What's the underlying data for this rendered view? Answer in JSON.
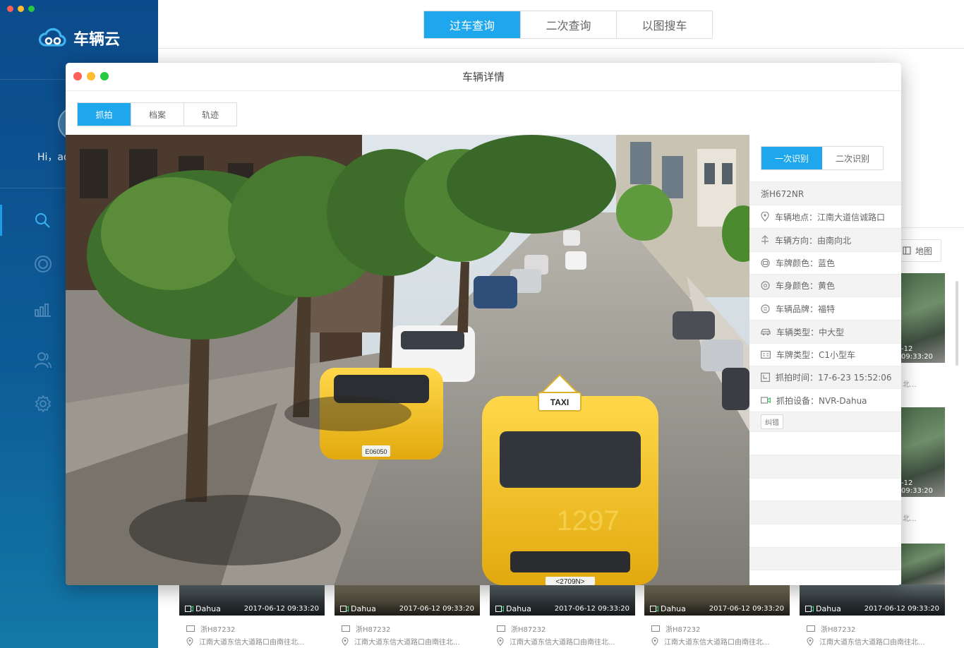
{
  "app": {
    "name": "车辆云",
    "greeting": "Hi，ad"
  },
  "sidebar": {
    "nav": [
      {
        "icon": "search-icon",
        "active": true
      },
      {
        "icon": "target-icon",
        "active": false
      },
      {
        "icon": "bar-chart-icon",
        "active": false
      },
      {
        "icon": "users-icon",
        "active": false
      },
      {
        "icon": "gear-icon",
        "active": false
      }
    ]
  },
  "top_tabs": [
    {
      "label": "过车查询",
      "active": true
    },
    {
      "label": "二次查询",
      "active": false
    },
    {
      "label": "以图搜车",
      "active": false
    }
  ],
  "toolbar": {
    "map_label": "地图"
  },
  "side_results": [
    {
      "time": "-12 09:33:20",
      "snippet": "北..."
    },
    {
      "time": "-12 09:33:20",
      "snippet": "北..."
    }
  ],
  "result_cards": [
    {
      "device": "Dahua",
      "time": "2017-06-12 09:33:20",
      "plate": "浙H87232",
      "address": "江南大道东信大道路口由南往北..."
    },
    {
      "device": "Dahua",
      "time": "2017-06-12 09:33:20",
      "plate": "浙H87232",
      "address": "江南大道东信大道路口由南往北..."
    },
    {
      "device": "Dahua",
      "time": "2017-06-12 09:33:20",
      "plate": "浙H87232",
      "address": "江南大道东信大道路口由南往北..."
    },
    {
      "device": "Dahua",
      "time": "2017-06-12 09:33:20",
      "plate": "浙H87232",
      "address": "江南大道东信大道路口由南往北..."
    },
    {
      "device": "Dahua",
      "time": "2017-06-12 09:33:20",
      "plate": "浙H87232",
      "address": "江南大道东信大道路口由南往北..."
    }
  ],
  "modal": {
    "title": "车辆详情",
    "tabs": [
      {
        "label": "抓拍",
        "active": true
      },
      {
        "label": "档案",
        "active": false
      },
      {
        "label": "轨迹",
        "active": false
      }
    ],
    "photo": {
      "taxi_sign": "TAXI",
      "plate_left": "E06050",
      "plate_right": "<2709N>",
      "body_number": "1297"
    },
    "recognition_tabs": [
      {
        "label": "一次识别",
        "active": true
      },
      {
        "label": "二次识别",
        "active": false
      }
    ],
    "plate": "浙H672NR",
    "details": [
      {
        "icon": "location-pin-icon",
        "text": "车辆地点：江南大道信诚路口"
      },
      {
        "icon": "direction-arrows-icon",
        "text": "车辆方向：由南向北"
      },
      {
        "icon": "plate-color-icon",
        "text": "车牌颜色：蓝色"
      },
      {
        "icon": "body-color-icon",
        "text": "车身颜色：黄色"
      },
      {
        "icon": "brand-icon",
        "text": "车辆品牌：福特"
      },
      {
        "icon": "car-icon",
        "text": "车辆类型：中大型"
      },
      {
        "icon": "plate-type-icon",
        "text": "车牌类型：C1小型车"
      },
      {
        "icon": "clock-icon",
        "text": "抓拍时间：17-6-23 15:52:06"
      },
      {
        "icon": "camera-icon",
        "text": "抓拍设备：NVR-Dahua"
      }
    ],
    "correct_label": "纠错"
  },
  "colors": {
    "accent": "#1ea7ed",
    "sidebar_top": "#0c4b8b",
    "sidebar_bottom": "#1378a8",
    "taxi_yellow": "#f2c21a"
  }
}
